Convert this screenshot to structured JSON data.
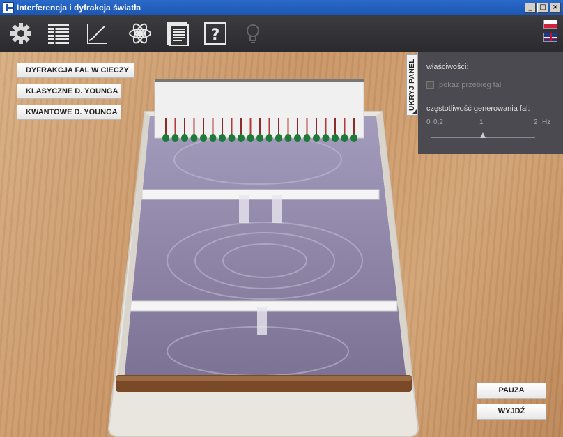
{
  "window": {
    "title": "Interferencja i dyfrakcja światła",
    "buttons": [
      "_",
      "□",
      "×"
    ]
  },
  "toolbar": {
    "tools": [
      {
        "name": "settings",
        "icon": "gear-icon"
      },
      {
        "name": "table",
        "icon": "table-icon"
      },
      {
        "name": "graph",
        "icon": "graph-icon"
      },
      {
        "name": "atom",
        "icon": "atom-icon"
      },
      {
        "name": "document",
        "icon": "document-icon"
      },
      {
        "name": "help",
        "icon": "help-icon"
      },
      {
        "name": "hint",
        "icon": "lightbulb-icon"
      }
    ],
    "languages": [
      {
        "code": "pl",
        "icon": "flag-pl-icon"
      },
      {
        "code": "en",
        "icon": "flag-uk-icon"
      }
    ]
  },
  "modes": [
    "DYFRAKCJA FAL W CIECZY",
    "KLASYCZNE D. YOUNGA",
    "KWANTOWE D. YOUNGA"
  ],
  "panel": {
    "toggle_label": "UKRYJ PANEL",
    "properties_label": "właściwości:",
    "show_waves_label": "pokaz przebieg fal",
    "show_waves_checked": false,
    "frequency_label": "częstotliwość generowania fal:",
    "slider": {
      "tick_labels": [
        "0",
        "0,2",
        "1",
        "2",
        "Hz"
      ],
      "min": 0,
      "max": 2,
      "value": 1
    }
  },
  "actions": {
    "pause_label": "PAUZA",
    "exit_label": "WYJDŹ"
  },
  "colors": {
    "titlebar": "#1c56b4",
    "toolbar": "#333337",
    "panel": "#4a4a50",
    "water": "#8e84a8",
    "wood": "#c89566"
  }
}
